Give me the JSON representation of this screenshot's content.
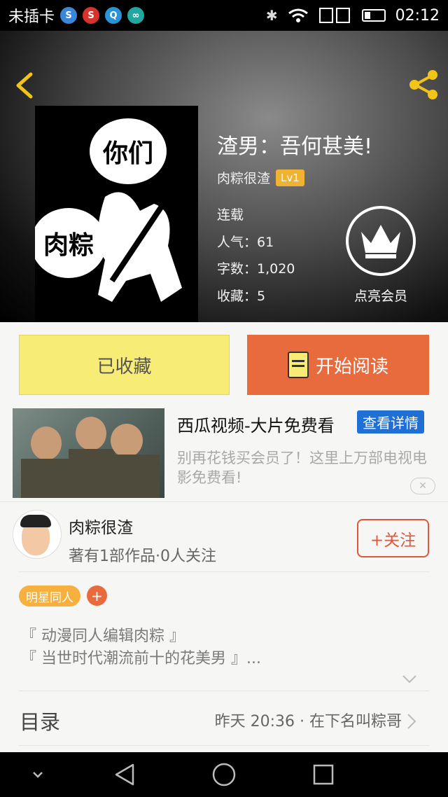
{
  "status_bar": {
    "carrier": "未插卡",
    "app_icons": [
      {
        "name": "sogou-icon",
        "glyph": "S",
        "color": "#3a86d8"
      },
      {
        "name": "weibo-icon",
        "glyph": "S",
        "color": "#d8322d"
      },
      {
        "name": "qq-icon",
        "glyph": "Q",
        "color": "#2a93d6"
      },
      {
        "name": "app-icon",
        "glyph": "∞",
        "color": "#22a7a0"
      }
    ],
    "time": "02:12"
  },
  "header": {
    "title": "渣男：吾何甚美!",
    "author": "肉粽很渣",
    "level": "Lv1",
    "status": "连载",
    "popularity": "人气：61",
    "word_count": "字数：1,020",
    "favorites": "收藏：5",
    "vip_label": "点亮会员",
    "cover_bubbles": [
      "你们",
      "肉粽"
    ]
  },
  "actions": {
    "favorited_label": "已收藏",
    "read_label": "开始阅读"
  },
  "ad": {
    "title": "西瓜视频-大片免费看",
    "detail_label": "查看详情",
    "description": "别再花钱买会员了！这里上万部电视电影免费看!",
    "close_glyph": "✕"
  },
  "author": {
    "name": "肉粽很渣",
    "stats": "著有1部作品·0人关注",
    "follow_label": "+关注"
  },
  "tags": {
    "items": [
      "明星同人"
    ],
    "add_label": "+"
  },
  "description_lines": [
    "『 动漫同人编辑肉粽 』",
    "『 当世时代潮流前十的花美男 』..."
  ],
  "catalog": {
    "label": "目录",
    "latest": "昨天 20:36 · 在下名叫粽哥"
  }
}
